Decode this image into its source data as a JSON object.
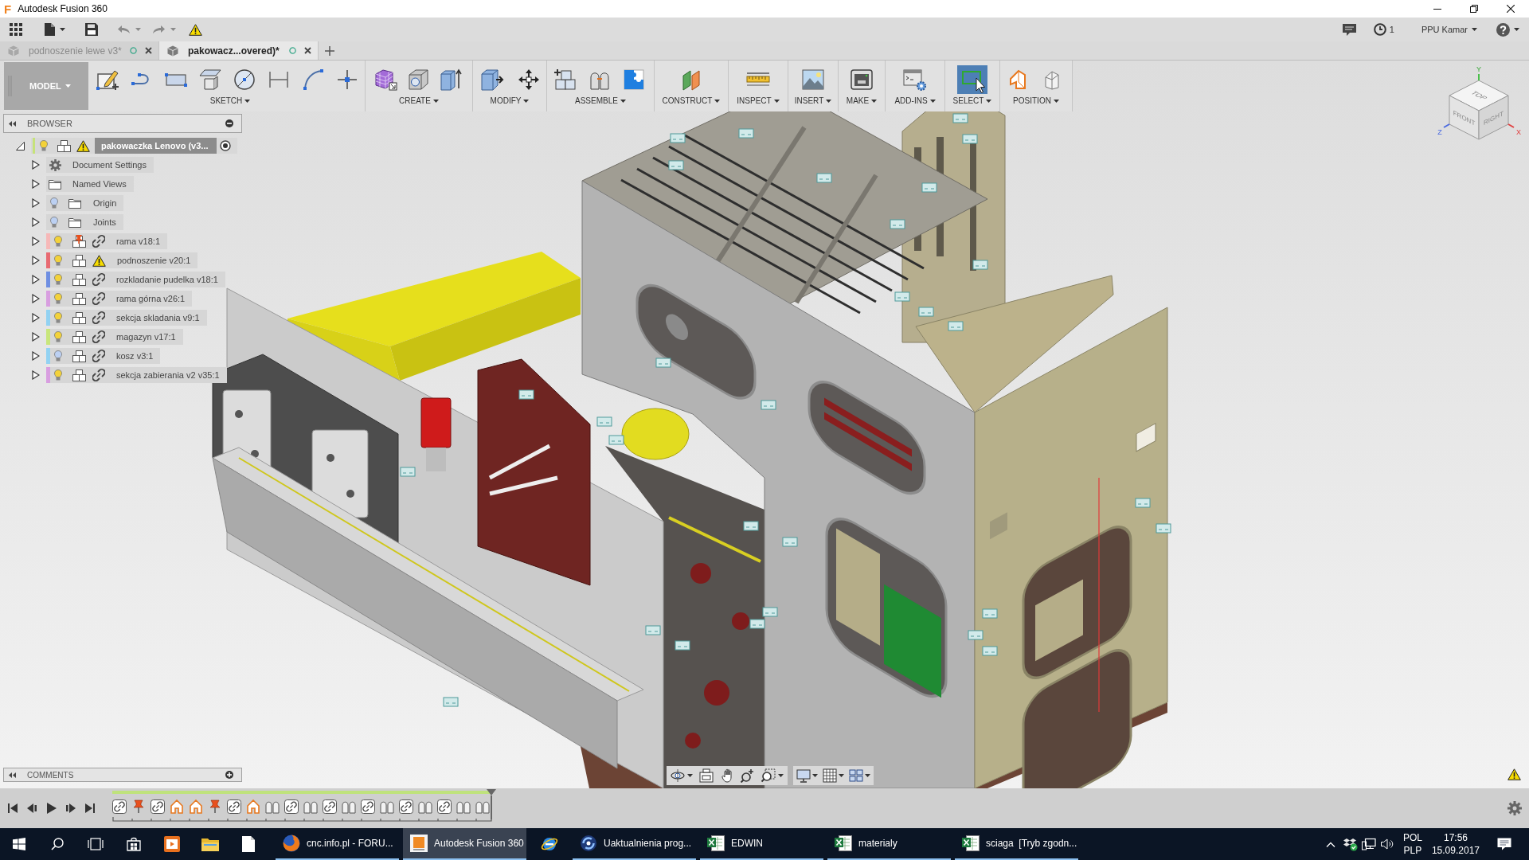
{
  "window": {
    "logo": "F",
    "title": "Autodesk Fusion 360"
  },
  "quick_access": {
    "job_count": "1",
    "user": "PPU Kamar"
  },
  "document_tabs": [
    {
      "label": "podnoszenie lewe v3*",
      "selected": false
    },
    {
      "label": "pakowacz...overed)*",
      "selected": true
    }
  ],
  "toolbar": {
    "workspace": "MODEL",
    "groups": [
      {
        "label": "SKETCH",
        "active": false
      },
      {
        "label": "CREATE",
        "active": false
      },
      {
        "label": "MODIFY",
        "active": false
      },
      {
        "label": "ASSEMBLE",
        "active": false
      },
      {
        "label": "CONSTRUCT",
        "active": false
      },
      {
        "label": "INSPECT",
        "active": false
      },
      {
        "label": "INSERT",
        "active": false
      },
      {
        "label": "MAKE",
        "active": false
      },
      {
        "label": "ADD-INS",
        "active": false
      },
      {
        "label": "SELECT",
        "active": true
      },
      {
        "label": "POSITION",
        "active": false
      }
    ]
  },
  "browser": {
    "title": "BROWSER",
    "root": {
      "label": "pakowaczka Lenovo (v3...",
      "expanded": true,
      "active": true,
      "visible": true,
      "color": "#c6e27a",
      "warning": true,
      "children": [
        {
          "label": "Document Settings",
          "kind": "settings",
          "expanded": false
        },
        {
          "label": "Named Views",
          "kind": "folder",
          "expanded": false
        },
        {
          "label": "Origin",
          "kind": "folder",
          "expanded": false,
          "visible": false
        },
        {
          "label": "Joints",
          "kind": "folder",
          "expanded": false,
          "visible": false
        },
        {
          "label": "rama v18:1",
          "kind": "component",
          "expanded": false,
          "visible": true,
          "color": "#f6b8b8",
          "grounded": true,
          "warning": false
        },
        {
          "label": "podnoszenie v20:1",
          "kind": "component",
          "expanded": false,
          "visible": true,
          "color": "#e86a72",
          "grounded": false,
          "warning": true
        },
        {
          "label": "rozkladanie pudelka v18:1",
          "kind": "component",
          "expanded": false,
          "visible": true,
          "color": "#6f8fe2",
          "grounded": false,
          "warning": false
        },
        {
          "label": "rama górna v26:1",
          "kind": "component",
          "expanded": false,
          "visible": true,
          "color": "#d89ee0",
          "grounded": false,
          "warning": false
        },
        {
          "label": "sekcja skladania v9:1",
          "kind": "component",
          "expanded": false,
          "visible": true,
          "color": "#92d2f2",
          "grounded": false,
          "warning": false
        },
        {
          "label": "magazyn v17:1",
          "kind": "component",
          "expanded": false,
          "visible": true,
          "color": "#c8e67c",
          "grounded": false,
          "warning": false
        },
        {
          "label": "kosz v3:1",
          "kind": "component",
          "expanded": false,
          "visible": false,
          "color": "#92d2f2",
          "grounded": false,
          "warning": false
        },
        {
          "label": "sekcja zabierania v2 v35:1",
          "kind": "component",
          "expanded": false,
          "visible": true,
          "color": "#d89ee0",
          "grounded": false,
          "warning": false
        }
      ]
    }
  },
  "comments": {
    "title": "COMMENTS"
  },
  "view_cube": {
    "top": "TOP",
    "front": "FRONT",
    "right": "RIGHT",
    "x_axis": "X",
    "y_axis": "Y",
    "z_axis": "Z"
  },
  "timeline": {
    "items": [
      {
        "kind": "link"
      },
      {
        "kind": "ground"
      },
      {
        "kind": "link"
      },
      {
        "kind": "rigid"
      },
      {
        "kind": "rigid"
      },
      {
        "kind": "ground"
      },
      {
        "kind": "link"
      },
      {
        "kind": "rigid"
      },
      {
        "kind": "joint"
      },
      {
        "kind": "link"
      },
      {
        "kind": "joint"
      },
      {
        "kind": "link"
      },
      {
        "kind": "joint"
      },
      {
        "kind": "link"
      },
      {
        "kind": "joint"
      },
      {
        "kind": "link"
      },
      {
        "kind": "joint"
      },
      {
        "kind": "link"
      },
      {
        "kind": "joint"
      },
      {
        "kind": "joint"
      }
    ]
  },
  "taskbar": {
    "windows": [
      {
        "label": "cnc.info.pl - FORU...",
        "selected": false
      },
      {
        "label": "Autodesk Fusion 360",
        "selected": true
      },
      {
        "label": "Uaktualnienia prog...",
        "selected": false
      },
      {
        "label": "EDWIN",
        "selected": false
      },
      {
        "label": "materialy",
        "selected": false
      },
      {
        "label": "sciaga  [Tryb zgodn...",
        "selected": false
      }
    ],
    "input_language": "POL",
    "keyboard_layout": "PLP",
    "time": "17:56",
    "date": "15.09.2017"
  }
}
